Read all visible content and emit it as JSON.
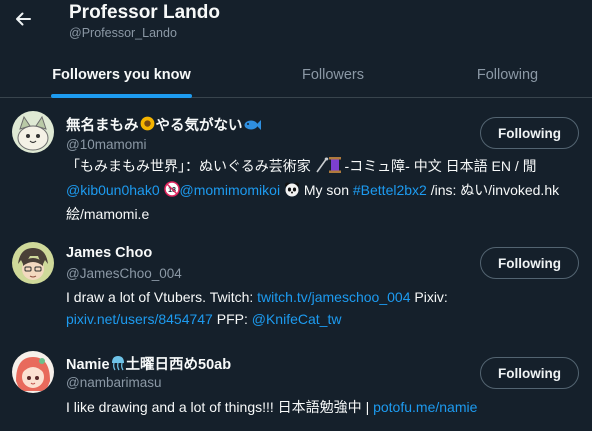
{
  "header": {
    "back_icon": "arrow-left-icon",
    "name": "Professor Lando",
    "handle": "@Professor_Lando"
  },
  "tabs": [
    {
      "label": "Followers you know",
      "active": true
    },
    {
      "label": "Followers",
      "active": false
    },
    {
      "label": "Following",
      "active": false
    }
  ],
  "users": [
    {
      "name_a": "無名まもみ",
      "name_b": "やる気がない",
      "handle": "@10mamomi",
      "follow_label": "Following",
      "bio": {
        "t1": "「もみまもみ世界」：ぬいぐるみ芸術家",
        "t2": "-コミュ障- 中文 日本語 EN /",
        "t3": "閒",
        "l1": "@kib0un0hak0",
        "l2": "@momimomikoi",
        "t4": "My son",
        "l3": "#Bettel2bx2",
        "t5": "/ins: ぬい/invoked.hk 絵/mamomi.e",
        "badge_18": "18"
      }
    },
    {
      "name": "James Choo",
      "handle": "@JamesChoo_004",
      "follow_label": "Following",
      "bio": {
        "t1": "I draw a lot of Vtubers. Twitch:",
        "l1": "twitch.tv/jameschoo_004",
        "t2": "Pixiv:",
        "l2": "pixiv.net/users/8454747",
        "t3": "PFP:",
        "l3": "@KnifeCat_tw"
      }
    },
    {
      "name_a": "Namie",
      "name_b": "土曜日西め50ab",
      "handle": "@nambarimasu",
      "follow_label": "Following",
      "bio": {
        "t1": "I like drawing and a lot of things!!! 日本語勉強中 |",
        "l1": "potofu.me/namie"
      }
    }
  ],
  "colors": {
    "background": "#15202b",
    "accent": "#1d9bf0",
    "secondary_text": "#8b98a5",
    "border": "#38444d"
  }
}
